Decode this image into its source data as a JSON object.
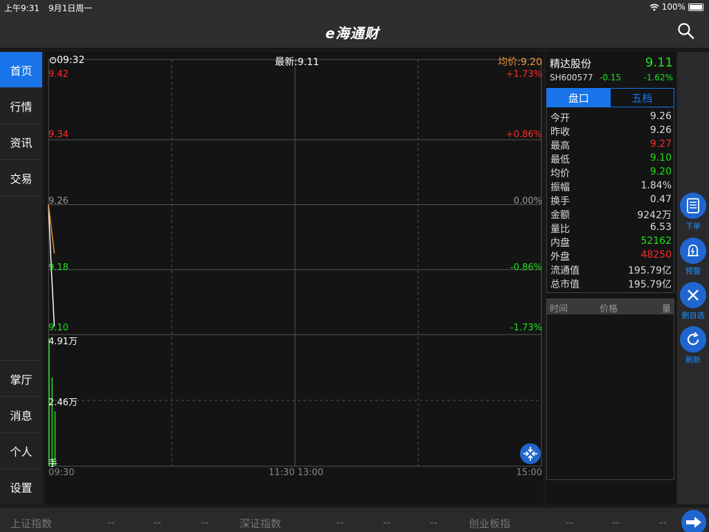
{
  "status": {
    "time": "上午9:31",
    "date": "9月1日周一",
    "battery": "100%"
  },
  "header": {
    "logo": "e海通财"
  },
  "sidebar": {
    "top": [
      {
        "label": "首页"
      },
      {
        "label": "行情"
      },
      {
        "label": "资讯"
      },
      {
        "label": "交易"
      }
    ],
    "bottom": [
      {
        "label": "掌厅"
      },
      {
        "label": "消息"
      },
      {
        "label": "个人"
      },
      {
        "label": "设置"
      }
    ]
  },
  "chart": {
    "time": "09:32",
    "latest": "最新:9.11",
    "avg": "均价:9.20",
    "y_left": [
      "9.42",
      "9.34",
      "9.26",
      "9.18",
      "9.10"
    ],
    "y_right": [
      "+1.73%",
      "+0.86%",
      "0.00%",
      "-0.86%",
      "-1.73%"
    ],
    "vol_labels": [
      "4.91万",
      "2.46万",
      "手"
    ],
    "x_labels": [
      "09:30",
      "11:30 13:00",
      "15:00"
    ],
    "colors": {
      "up": "#ff2a2a",
      "down": "#1ee21e",
      "flat": "#999999",
      "avg": "#f0962e",
      "price": "#ffffff"
    }
  },
  "chart_data": {
    "type": "line",
    "xlabel": "",
    "ylabel": "",
    "ylim": [
      9.1,
      9.42
    ],
    "x": [
      "09:30",
      "09:31",
      "09:32"
    ],
    "series": [
      {
        "name": "最新",
        "values": [
          9.26,
          9.18,
          9.11
        ]
      },
      {
        "name": "均价",
        "values": [
          9.26,
          9.23,
          9.2
        ]
      }
    ],
    "volume": {
      "values": [
        49100,
        34000,
        21000
      ],
      "ylim": [
        0,
        49100
      ]
    }
  },
  "stock": {
    "name": "精达股份",
    "price": "9.11",
    "code": "SH600577",
    "change": "-0.15",
    "pct": "-1.62%"
  },
  "tabs": [
    {
      "label": "盘口"
    },
    {
      "label": "五档"
    }
  ],
  "quote": [
    {
      "k": "今开",
      "v": "9.26",
      "c": "#dddddd"
    },
    {
      "k": "昨收",
      "v": "9.26",
      "c": "#dddddd"
    },
    {
      "k": "最高",
      "v": "9.27",
      "c": "#ff2a2a"
    },
    {
      "k": "最低",
      "v": "9.10",
      "c": "#1ee21e"
    },
    {
      "k": "均价",
      "v": "9.20",
      "c": "#1ee21e"
    },
    {
      "k": "振幅",
      "v": "1.84%",
      "c": "#dddddd"
    },
    {
      "k": "换手",
      "v": "0.47",
      "c": "#dddddd"
    },
    {
      "k": "金额",
      "v": "9242万",
      "c": "#dddddd"
    },
    {
      "k": "量比",
      "v": "6.53",
      "c": "#dddddd"
    },
    {
      "k": "内盘",
      "v": "52162",
      "c": "#1ee21e"
    },
    {
      "k": "外盘",
      "v": "48250",
      "c": "#ff2a2a"
    },
    {
      "k": "流通值",
      "v": "195.79亿",
      "c": "#dddddd"
    },
    {
      "k": "总市值",
      "v": "195.79亿",
      "c": "#dddddd"
    }
  ],
  "trades": {
    "col_time": "时间",
    "col_price": "价格",
    "col_vol": "量"
  },
  "actions": [
    {
      "label": "下单",
      "icon": "order-icon"
    },
    {
      "label": "预警",
      "icon": "alarm-icon"
    },
    {
      "label": "删自选",
      "icon": "close-icon"
    },
    {
      "label": "刷新",
      "icon": "refresh-icon"
    }
  ],
  "indices": [
    {
      "name": "上证指数",
      "v1": "--",
      "v2": "--",
      "v3": "--"
    },
    {
      "name": "深证指数",
      "v1": "--",
      "v2": "--",
      "v3": "--"
    },
    {
      "name": "创业板指",
      "v1": "--",
      "v2": "--",
      "v3": "--"
    }
  ]
}
